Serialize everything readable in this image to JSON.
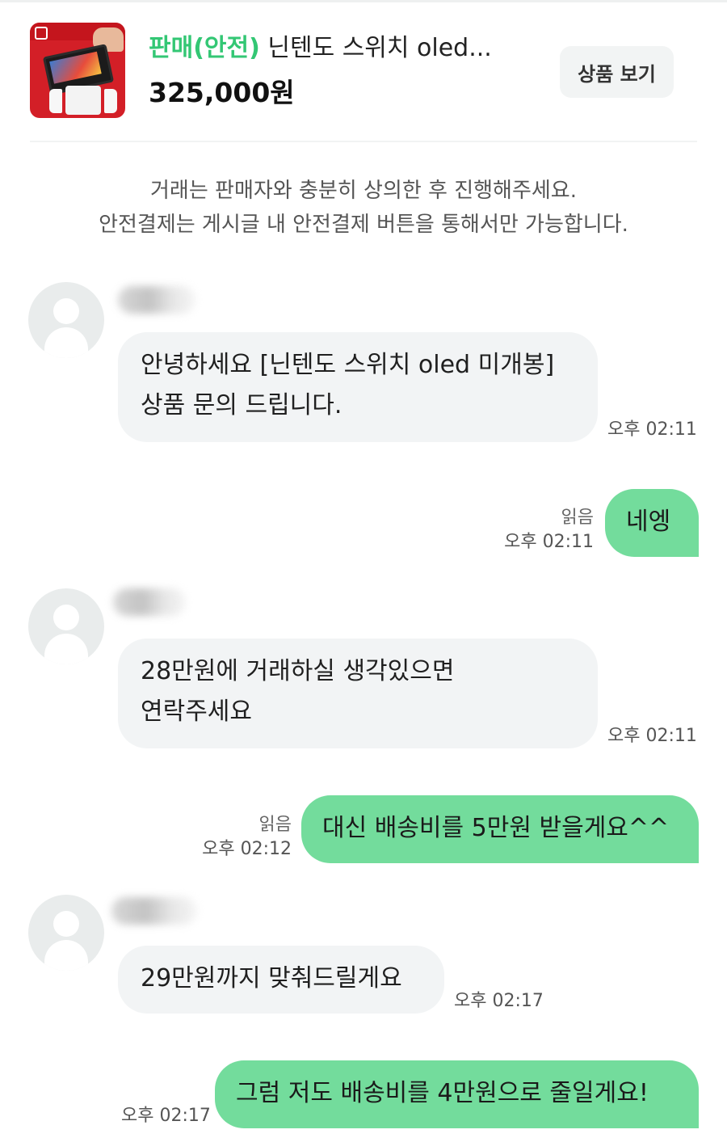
{
  "product": {
    "tag": "판매(안전)",
    "name": " 닌텐도 스위치 oled...",
    "price": "325,000원",
    "view_button": "상품 보기",
    "thumbnail_icon": "nintendo-switch-box-image"
  },
  "notice": {
    "line1": "거래는 판매자와 충분히 상의한 후 진행해주세요.",
    "line2": "안전결제는 게시글 내 안전결제 버튼을 통해서만 가능합니다."
  },
  "messages": [
    {
      "side": "in",
      "lines": [
        "안녕하세요 [닌텐도 스위치 oled 미개봉]",
        "상품 문의 드립니다."
      ],
      "time": "오후 02:11"
    },
    {
      "side": "out",
      "text": "네엥",
      "read": "읽음",
      "time": "오후 02:11"
    },
    {
      "side": "in",
      "lines": [
        "28만원에 거래하실 생각있으면",
        "연락주세요"
      ],
      "time": "오후 02:11"
    },
    {
      "side": "out",
      "text": "대신 배송비를 5만원 받을게요^^",
      "read": "읽음",
      "time": "오후 02:12"
    },
    {
      "side": "in",
      "lines": [
        "29만원까지 맞춰드릴게요"
      ],
      "time": "오후 02:17"
    },
    {
      "side": "out",
      "text": "그럼 저도 배송비를 4만원으로 줄일게요!",
      "time": "오후 02:17"
    }
  ],
  "colors": {
    "accent": "#33c774",
    "outgoing_bubble": "#73dc9c",
    "incoming_bubble": "#f2f4f5"
  }
}
